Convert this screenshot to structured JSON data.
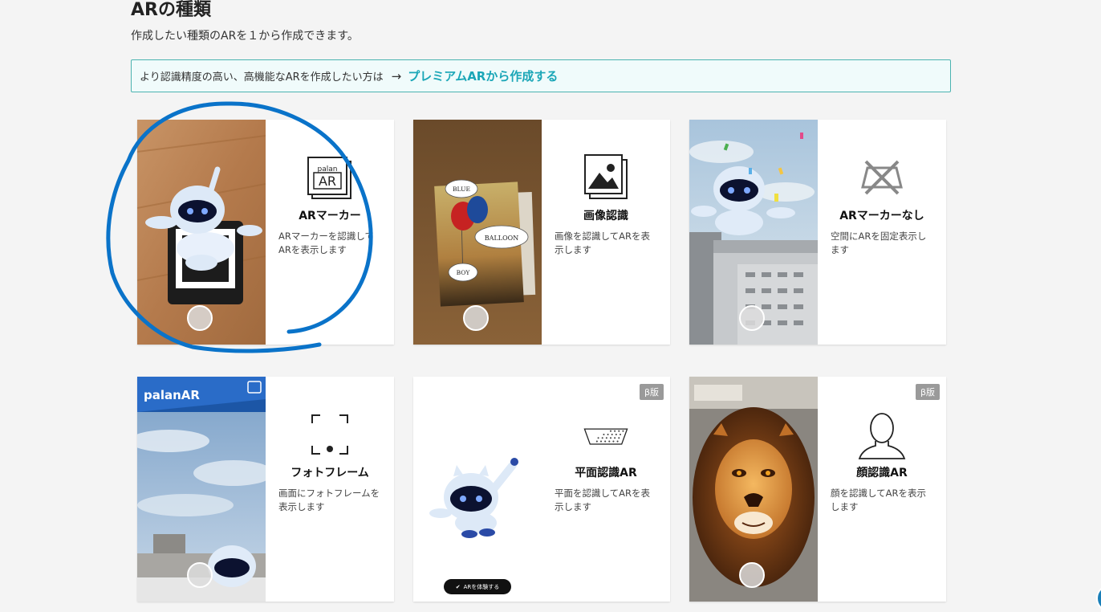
{
  "header": {
    "title": "ARの種類",
    "subtitle": "作成したい種類のARを１から作成できます。"
  },
  "notice": {
    "text": "より認識精度の高い、高機能なARを作成したい方は",
    "arrow": "→",
    "link_label": "プレミアムARから作成する"
  },
  "cards": [
    {
      "title": "ARマーカー",
      "desc": "ARマーカーを認識してARを表示します",
      "icon": "ar-marker-icon",
      "icon_text_top": "palan",
      "icon_text_main": "AR"
    },
    {
      "title": "画像認識",
      "desc": "画像を認識してARを表示します",
      "icon": "image-icon",
      "bubbles": [
        "BLUE",
        "BALLOON",
        "BOY"
      ]
    },
    {
      "title": "ARマーカーなし",
      "desc": "空間にARを固定表示します",
      "icon": "no-marker-icon"
    },
    {
      "title": "フォトフレーム",
      "desc": "画面にフォトフレームを表示します",
      "icon": "frame-icon",
      "photo_logo": "palanAR"
    },
    {
      "title": "平面認識AR",
      "desc": "平面を認識してARを表示します",
      "icon": "plane-icon",
      "badge": "β版",
      "try_label": "ARを体験する"
    },
    {
      "title": "顔認識AR",
      "desc": "顔を認識してARを表示します",
      "icon": "face-icon",
      "badge": "β版"
    }
  ],
  "colors": {
    "accent": "#1aa6b7",
    "notice_border": "#4bb3b0",
    "scribble": "#0a73c9"
  }
}
